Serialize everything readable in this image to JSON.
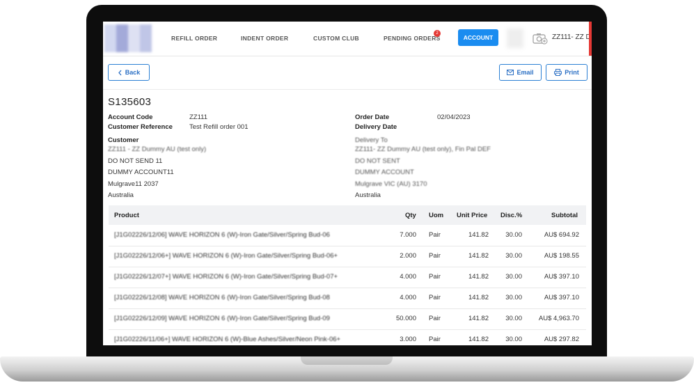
{
  "nav": {
    "items": [
      "REFILL ORDER",
      "INDENT ORDER",
      "CUSTOM CLUB",
      "PENDING ORDERS"
    ],
    "pending_badge": "2",
    "account_label": "ACCOUNT",
    "user_code": "ZZ111- ZZ D"
  },
  "actions": {
    "back": "Back",
    "email": "Email",
    "print": "Print"
  },
  "order": {
    "number": "S135603",
    "account_code_label": "Account Code",
    "account_code": "ZZ111",
    "customer_ref_label": "Customer Reference",
    "customer_ref": "Test Refill order 001",
    "order_date_label": "Order Date",
    "order_date": "02/04/2023",
    "delivery_date_label": "Delivery Date",
    "customer_label": "Customer",
    "customer_lines": [
      "ZZ111 - ZZ Dummy AU (test only)",
      "DO NOT SEND 11",
      "DUMMY ACCOUNT11",
      "Mulgrave11 2037",
      "Australia"
    ],
    "delivery_label": "Delivery To",
    "delivery_lines": [
      "ZZ111- ZZ Dummy AU (test only), Fin Pal DEF",
      "DO NOT SENT",
      "DUMMY ACCOUNT",
      "Mulgrave VIC (AU) 3170",
      "Australia"
    ]
  },
  "table": {
    "headers": [
      "Product",
      "Qty",
      "Uom",
      "Unit Price",
      "Disc.%",
      "Subtotal"
    ],
    "rows": [
      {
        "product": "[J1G02226/12/06] WAVE HORIZON 6 (W)-Iron Gate/Silver/Spring Bud-06",
        "qty": "7.000",
        "uom": "Pair",
        "price": "141.82",
        "disc": "30.00",
        "subtotal": "AU$ 694.92"
      },
      {
        "product": "[J1G02226/12/06+] WAVE HORIZON 6 (W)-Iron Gate/Silver/Spring Bud-06+",
        "qty": "2.000",
        "uom": "Pair",
        "price": "141.82",
        "disc": "30.00",
        "subtotal": "AU$ 198.55"
      },
      {
        "product": "[J1G02226/12/07+] WAVE HORIZON 6 (W)-Iron Gate/Silver/Spring Bud-07+",
        "qty": "4.000",
        "uom": "Pair",
        "price": "141.82",
        "disc": "30.00",
        "subtotal": "AU$ 397.10"
      },
      {
        "product": "[J1G02226/12/08] WAVE HORIZON 6 (W)-Iron Gate/Silver/Spring Bud-08",
        "qty": "4.000",
        "uom": "Pair",
        "price": "141.82",
        "disc": "30.00",
        "subtotal": "AU$ 397.10"
      },
      {
        "product": "[J1G02226/12/09] WAVE HORIZON 6 (W)-Iron Gate/Silver/Spring Bud-09",
        "qty": "50.000",
        "uom": "Pair",
        "price": "141.82",
        "disc": "30.00",
        "subtotal": "AU$ 4,963.70"
      },
      {
        "product": "[J1G02226/11/06+] WAVE HORIZON 6 (W)-Blue Ashes/Silver/Neon Pink-06+",
        "qty": "3.000",
        "uom": "Pair",
        "price": "141.82",
        "disc": "30.00",
        "subtotal": "AU$ 297.82"
      }
    ]
  },
  "colors": {
    "accent": "#1a8cf0",
    "badge": "#e53935"
  },
  "icons": [
    "chevron-left-icon",
    "mail-icon",
    "printer-icon",
    "camera-add-icon"
  ]
}
